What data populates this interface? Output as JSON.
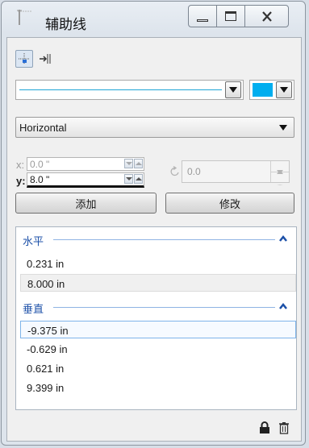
{
  "window": {
    "title": "辅助线",
    "icon": "guidelines-app-icon",
    "buttons": [
      "minimize-icon",
      "maximize-icon",
      "close-icon"
    ]
  },
  "toolbar": {
    "tools": [
      {
        "name": "guideline-tool",
        "icon": "guideline-grid-icon",
        "active": true
      },
      {
        "name": "snap-guideline-tool",
        "icon": "snap-to-guideline-icon",
        "active": false
      }
    ]
  },
  "line_style": {
    "selected": "solid-line",
    "color": "#1fa6d6"
  },
  "color_picker": {
    "color": "#00aeef"
  },
  "orientation": {
    "selected": "Horizontal"
  },
  "coordinates": {
    "x_label": "x:",
    "x_value": "0.0 \"",
    "y_label": "y:",
    "y_value": "8.0 \"",
    "angle_value": "0.0"
  },
  "buttons": {
    "add": "添加",
    "modify": "修改"
  },
  "groups": [
    {
      "title": "水平",
      "expanded": true,
      "items": [
        "0.231 in",
        "8.000 in"
      ],
      "selected_index": 1
    },
    {
      "title": "垂直",
      "expanded": true,
      "items": [
        "-9.375 in",
        "-0.629 in",
        "0.621 in",
        "9.399 in"
      ],
      "highlighted_index": 0
    }
  ],
  "footer": {
    "icons": [
      "lock-icon",
      "delete-icon"
    ]
  }
}
